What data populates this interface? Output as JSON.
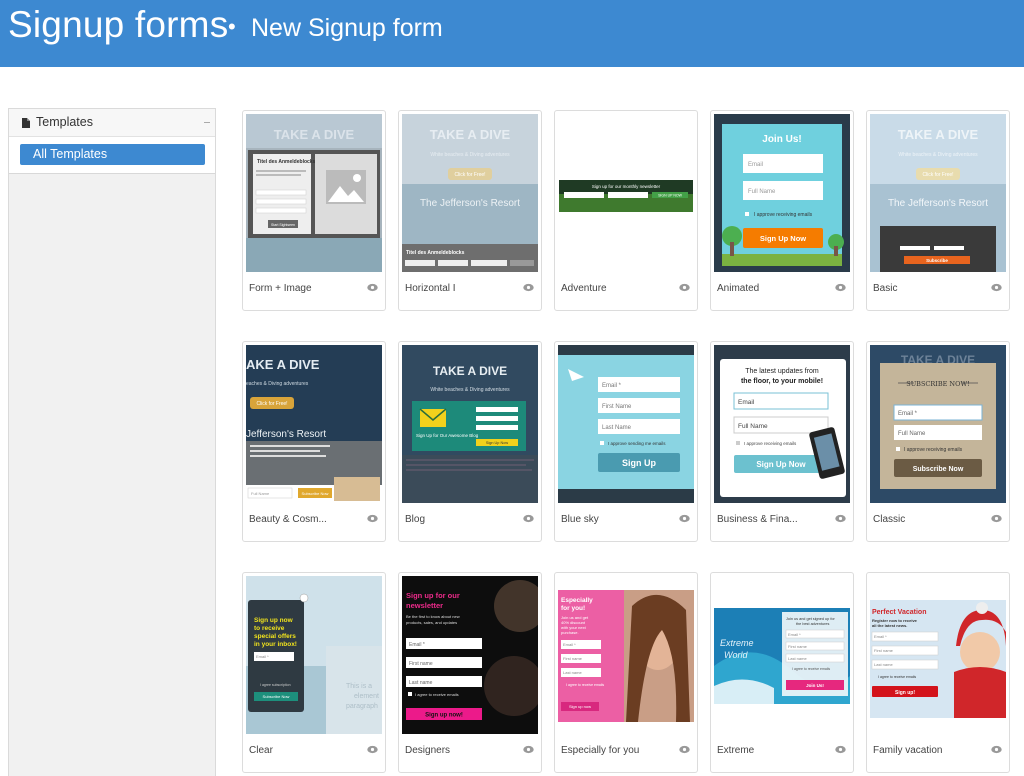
{
  "header": {
    "title": "Signup forms",
    "separator": "•",
    "subtitle": "New Signup form"
  },
  "sidebar": {
    "section_label": "Templates",
    "items": [
      {
        "label": "All Templates",
        "selected": true
      }
    ]
  },
  "templates": [
    {
      "name": "Form + Image",
      "preview_text": [
        "TAKE A DIVE",
        "Titel des Anmeldeblocks",
        "Start Sightseen"
      ]
    },
    {
      "name": "Horizontal I",
      "preview_text": [
        "TAKE A DIVE",
        "White beaches & Diving adventures",
        "Click for Free!",
        "The Jefferson's Resort",
        "Titel des Anmeldeblocks"
      ]
    },
    {
      "name": "Adventure",
      "preview_text": [
        "Sign up for our monthly newsletter",
        "SIGN UP NOW"
      ]
    },
    {
      "name": "Animated",
      "preview_text": [
        "Join Us!",
        "Email",
        "Full Name",
        "I approve receiving emails",
        "Sign Up Now"
      ]
    },
    {
      "name": "Basic",
      "preview_text": [
        "TAKE A DIVE",
        "White beaches & Diving adventures",
        "Click for Free!",
        "The Jefferson's Resort",
        "Subscribe"
      ]
    },
    {
      "name": "Beauty & Cosm...",
      "preview_text": [
        "AKE A DIVE",
        "eaches & Diving adventures",
        "Click for Free!",
        "Jefferson's Resort",
        "Full Name",
        "Subscribe Now"
      ]
    },
    {
      "name": "Blog",
      "preview_text": [
        "TAKE A DIVE",
        "White beaches & Diving adventures",
        "Sign Up for Our Awesome Blog",
        "Sign Up Now"
      ]
    },
    {
      "name": "Blue sky",
      "preview_text": [
        "Email *",
        "First Name",
        "Last Name",
        "I approve sending me emails",
        "Sign Up"
      ]
    },
    {
      "name": "Business & Fina...",
      "preview_text": [
        "The latest updates from",
        "the floor, to your mobile!",
        "Email",
        "Full Name",
        "I approve receiving emails",
        "Sign Up Now"
      ]
    },
    {
      "name": "Classic",
      "preview_text": [
        "TAKE A DIVE",
        "SUBSCRIBE NOW!",
        "Email *",
        "Full Name",
        "I approve receiving emails",
        "Subscribe Now"
      ]
    },
    {
      "name": "Clear",
      "preview_text": [
        "Sign up now",
        "to receive",
        "special offers",
        "in your inbox!",
        "Email *",
        "I agree subscription",
        "Subscribe Now",
        "This is a",
        "element",
        "paragraph"
      ]
    },
    {
      "name": "Designers",
      "preview_text": [
        "Sign up for our",
        "newsletter",
        "Be the first to know about new",
        "products, sales, and updates",
        "Email *",
        "First name",
        "Last name",
        "I agree to receive emails",
        "Sign up now!"
      ]
    },
    {
      "name": "Especially for you",
      "preview_text": [
        "Especially",
        "for you!",
        "Join us and get",
        "40% discount",
        "with your next",
        "purchase.",
        "Email *",
        "First name",
        "Last name",
        "I agree to receive emails",
        "Sign up now"
      ]
    },
    {
      "name": "Extreme",
      "preview_text": [
        "Join us and get signed up for",
        "the best adventures",
        "Email *",
        "First name",
        "Last name",
        "I agree to receive emails",
        "Join Us!",
        "Extreme",
        "World"
      ]
    },
    {
      "name": "Family vacation",
      "preview_text": [
        "Perfect Vacation",
        "Register now to receive",
        "all the latest news.",
        "Email *",
        "First name",
        "Last name",
        "I agree to receive emails",
        "Sign up!"
      ]
    }
  ],
  "colors": {
    "header": "#3d89d1",
    "selected_item": "#3d89d1"
  }
}
